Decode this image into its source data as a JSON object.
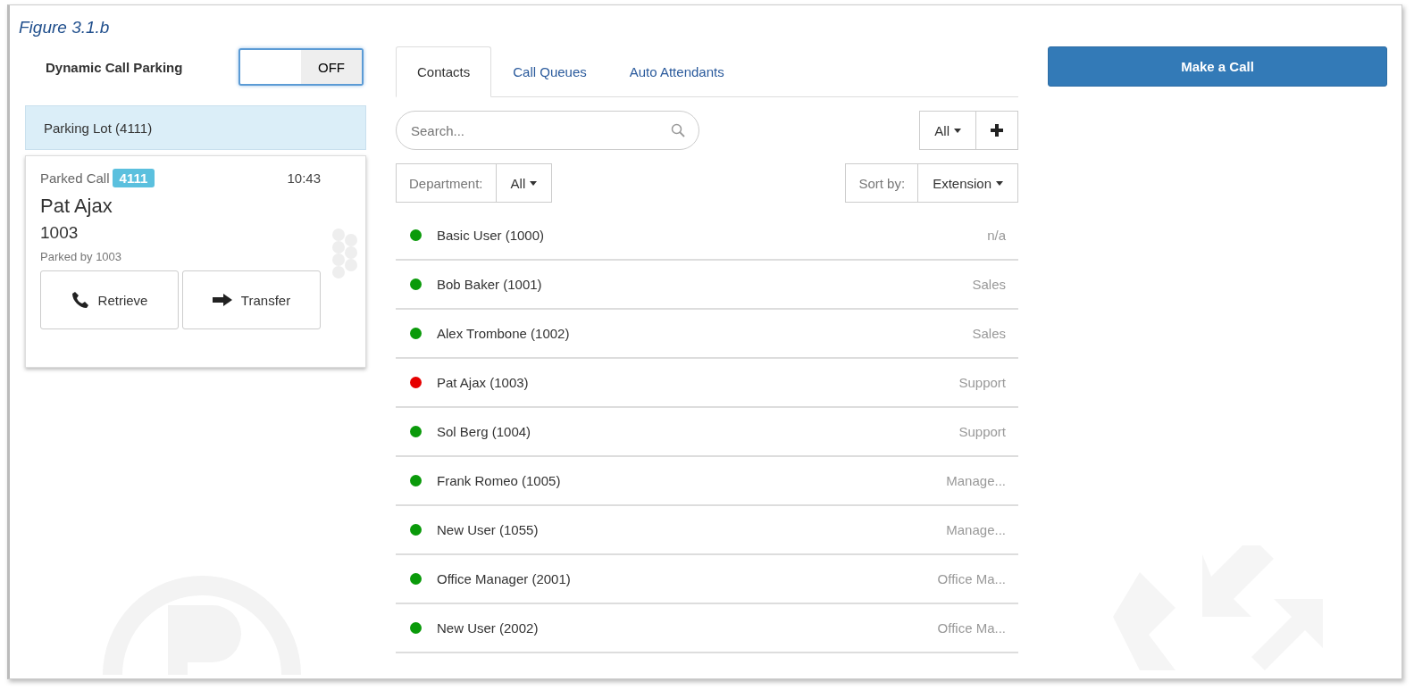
{
  "caption": "Figure 3.1.b",
  "parking": {
    "label": "Dynamic Call Parking",
    "toggle": {
      "on": false,
      "text": "OFF"
    },
    "lot": "Parking Lot (4111)",
    "call": {
      "title": "Parked Call",
      "badge": "4111",
      "time": "10:43",
      "name": "Pat Ajax",
      "number": "1003",
      "parked_by": "Parked by 1003",
      "buttons": [
        {
          "kind": "phone",
          "label": "Retrieve"
        },
        {
          "kind": "arrow",
          "label": "Transfer"
        }
      ]
    }
  },
  "tabs": [
    {
      "label": "Contacts",
      "selected": true
    },
    {
      "label": "Call Queues",
      "selected": false
    },
    {
      "label": "Auto Attendants",
      "selected": false
    }
  ],
  "search": {
    "placeholder": "Search..."
  },
  "filter": {
    "value": "All"
  },
  "department": {
    "label": "Department:",
    "value": "All"
  },
  "sort": {
    "label": "Sort by:",
    "value": "Extension"
  },
  "contacts": [
    {
      "name": "Basic User (1000)",
      "department": "n/a",
      "color": "#0a9a0a"
    },
    {
      "name": "Bob Baker (1001)",
      "department": "Sales",
      "color": "#0a9a0a"
    },
    {
      "name": "Alex Trombone (1002)",
      "department": "Sales",
      "color": "#0a9a0a"
    },
    {
      "name": "Pat Ajax (1003)",
      "department": "Support",
      "color": "#e60000"
    },
    {
      "name": "Sol Berg (1004)",
      "department": "Support",
      "color": "#0a9a0a"
    },
    {
      "name": "Frank Romeo (1005)",
      "department": "Manage...",
      "color": "#0a9a0a"
    },
    {
      "name": "New User (1055)",
      "department": "Manage...",
      "color": "#0a9a0a"
    },
    {
      "name": "Office Manager (2001)",
      "department": "Office Ma...",
      "color": "#0a9a0a"
    },
    {
      "name": "New User (2002)",
      "department": "Office Ma...",
      "color": "#0a9a0a"
    }
  ],
  "make_call": {
    "label": "Make a Call"
  }
}
